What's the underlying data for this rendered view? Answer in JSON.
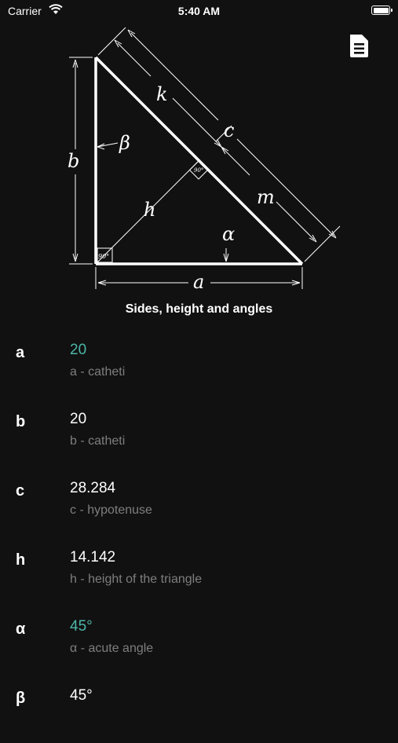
{
  "status_bar": {
    "carrier": "Carrier",
    "time": "5:40 AM"
  },
  "toolbar": {
    "icon": "document-icon"
  },
  "diagram": {
    "labels": {
      "k": "k",
      "c": "c",
      "b": "b",
      "beta": "β",
      "h": "h",
      "m": "m",
      "alpha": "α",
      "a": "a",
      "right_angle": "90°"
    }
  },
  "caption": "Sides, height and angles",
  "accent_color": "#4db6a8",
  "rows": [
    {
      "symbol": "a",
      "value": "20",
      "description": "a - catheti"
    },
    {
      "symbol": "b",
      "value": "20",
      "description": "b - catheti"
    },
    {
      "symbol": "c",
      "value": "28.284",
      "description": "c - hypotenuse"
    },
    {
      "symbol": "h",
      "value": "14.142",
      "description": "h - height of the triangle"
    },
    {
      "symbol": "α",
      "value": "45°",
      "description": "α - acute angle"
    },
    {
      "symbol": "β",
      "value": "45°",
      "description": ""
    }
  ]
}
